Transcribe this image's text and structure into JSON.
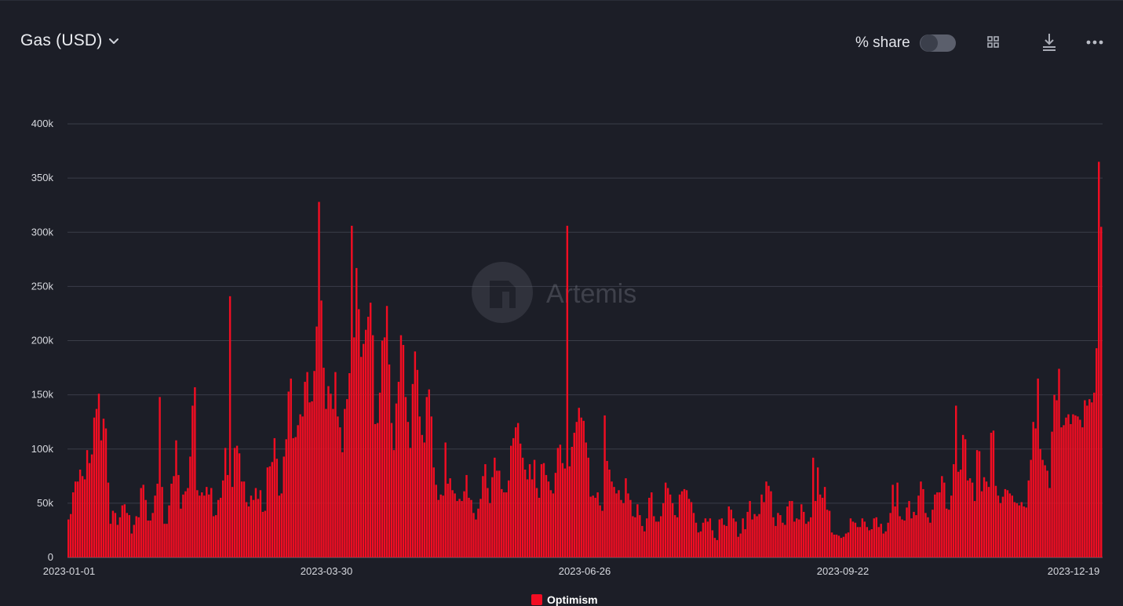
{
  "header": {
    "title": "Gas (USD)",
    "share_label": "% share",
    "share_enabled": false,
    "icons": [
      "chevron-down-icon",
      "grid-icon",
      "download-icon",
      "more-icon"
    ]
  },
  "watermark": {
    "text": "Artemis"
  },
  "colors": {
    "background": "#1c1e27",
    "bar": "#f20d22",
    "grid": "#3a3d48",
    "axis_text": "#d7d9df"
  },
  "chart_data": {
    "type": "bar",
    "title": "Gas (USD)",
    "series": [
      {
        "name": "Optimism",
        "start_date": "2023-01-01",
        "values": [
          35000,
          40000,
          60000,
          70000,
          70000,
          81000,
          75000,
          72000,
          99000,
          87000,
          95000,
          129000,
          137000,
          151000,
          108000,
          128000,
          119000,
          69000,
          31000,
          43000,
          41000,
          30000,
          37000,
          48000,
          49000,
          41000,
          39000,
          22000,
          30000,
          38000,
          37000,
          64000,
          67000,
          53000,
          34000,
          34000,
          41000,
          57000,
          68000,
          148000,
          65000,
          31000,
          31000,
          48000,
          68000,
          75000,
          108000,
          76000,
          45000,
          58000,
          61000,
          64000,
          93000,
          140000,
          157000,
          62000,
          57000,
          60000,
          57000,
          65000,
          58000,
          64000,
          38000,
          39000,
          53000,
          55000,
          71000,
          101000,
          76000,
          241000,
          65000,
          101000,
          103000,
          96000,
          70000,
          70000,
          51000,
          47000,
          57000,
          53000,
          64000,
          54000,
          62000,
          42000,
          43000,
          83000,
          84000,
          88000,
          110000,
          91000,
          57000,
          59000,
          93000,
          109000,
          153000,
          165000,
          110000,
          111000,
          122000,
          132000,
          130000,
          162000,
          171000,
          143000,
          144000,
          172000,
          213000,
          328000,
          237000,
          175000,
          137000,
          158000,
          151000,
          137000,
          171000,
          130000,
          120000,
          97000,
          137000,
          146000,
          170000,
          306000,
          203000,
          267000,
          229000,
          185000,
          197000,
          210000,
          222000,
          235000,
          205000,
          123000,
          124000,
          152000,
          200000,
          203000,
          232000,
          178000,
          124000,
          99000,
          142000,
          162000,
          205000,
          196000,
          148000,
          125000,
          101000,
          160000,
          190000,
          173000,
          130000,
          113000,
          106000,
          148000,
          155000,
          130000,
          83000,
          67000,
          53000,
          58000,
          57000,
          106000,
          68000,
          73000,
          62000,
          59000,
          52000,
          54000,
          52000,
          61000,
          76000,
          55000,
          53000,
          41000,
          35000,
          45000,
          54000,
          75000,
          86000,
          64000,
          50000,
          74000,
          92000,
          80000,
          80000,
          63000,
          60000,
          60000,
          71000,
          103000,
          110000,
          120000,
          124000,
          105000,
          92000,
          81000,
          72000,
          86000,
          72000,
          90000,
          64000,
          55000,
          86000,
          87000,
          76000,
          70000,
          62000,
          59000,
          78000,
          101000,
          104000,
          87000,
          82000,
          306000,
          84000,
          102000,
          115000,
          125000,
          138000,
          129000,
          126000,
          106000,
          92000,
          56000,
          57000,
          55000,
          60000,
          48000,
          43000,
          131000,
          89000,
          81000,
          70000,
          65000,
          59000,
          62000,
          53000,
          50000,
          73000,
          59000,
          53000,
          38000,
          37000,
          49000,
          39000,
          29000,
          24000,
          36000,
          55000,
          60000,
          38000,
          33000,
          33000,
          38000,
          50000,
          69000,
          64000,
          58000,
          50000,
          39000,
          37000,
          58000,
          61000,
          63000,
          62000,
          54000,
          51000,
          41000,
          32000,
          23000,
          24000,
          32000,
          36000,
          33000,
          36000,
          25000,
          18000,
          16000,
          35000,
          36000,
          30000,
          29000,
          47000,
          44000,
          36000,
          33000,
          19000,
          22000,
          36000,
          26000,
          42000,
          52000,
          35000,
          40000,
          38000,
          40000,
          58000,
          51000,
          70000,
          66000,
          61000,
          37000,
          29000,
          41000,
          39000,
          32000,
          30000,
          47000,
          52000,
          52000,
          33000,
          36000,
          35000,
          49000,
          42000,
          31000,
          33000,
          37000,
          92000,
          52000,
          83000,
          58000,
          55000,
          65000,
          44000,
          43000,
          23000,
          21000,
          21000,
          20000,
          18000,
          19000,
          22000,
          23000,
          36000,
          33000,
          32000,
          28000,
          28000,
          36000,
          33000,
          28000,
          25000,
          26000,
          36000,
          37000,
          28000,
          31000,
          22000,
          24000,
          32000,
          41000,
          67000,
          47000,
          69000,
          38000,
          35000,
          34000,
          46000,
          52000,
          36000,
          42000,
          39000,
          57000,
          70000,
          63000,
          41000,
          37000,
          32000,
          44000,
          58000,
          60000,
          60000,
          75000,
          69000,
          45000,
          44000,
          57000,
          86000,
          140000,
          79000,
          81000,
          113000,
          109000,
          71000,
          73000,
          69000,
          52000,
          99000,
          98000,
          61000,
          74000,
          70000,
          65000,
          115000,
          117000,
          66000,
          57000,
          50000,
          56000,
          63000,
          62000,
          59000,
          57000,
          51000,
          50000,
          48000,
          51000,
          47000,
          46000,
          71000,
          90000,
          125000,
          119000,
          165000,
          100000,
          90000,
          85000,
          80000,
          64000,
          116000,
          150000,
          145000,
          174000,
          120000,
          122000,
          129000,
          132000,
          123000,
          132000,
          131000,
          130000,
          127000,
          120000,
          145000,
          140000,
          146000,
          143000,
          152000,
          193000,
          365000,
          305000
        ]
      }
    ],
    "xlabel": "",
    "ylabel": "",
    "x_tick_labels": [
      "2023-01-01",
      "2023-03-30",
      "2023-06-26",
      "2023-09-22",
      "2023-12-19"
    ],
    "y_tick_labels": [
      "0",
      "50k",
      "100k",
      "150k",
      "200k",
      "250k",
      "300k",
      "350k",
      "400k"
    ],
    "ylim": [
      0,
      400000
    ],
    "grid": true,
    "legend_position": "bottom-center"
  }
}
